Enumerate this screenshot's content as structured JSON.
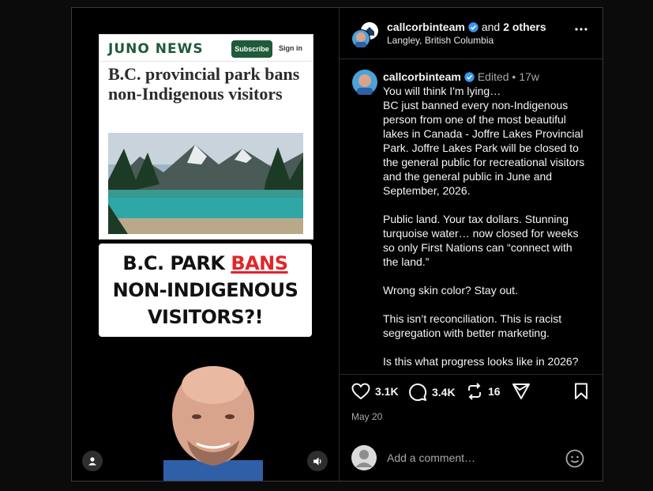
{
  "media": {
    "news_brand": "JUNO NEWS",
    "subscribe_label": "Subscribe",
    "signin_label": "Sign in",
    "headline": "B.C. provincial park bans non-Indigenous visitors",
    "banner_line1_prefix": "B.C. PARK ",
    "banner_line1_highlight": "BANS",
    "banner_line2": "NON-INDIGENOUS",
    "banner_line3": "VISITORS?!"
  },
  "header": {
    "username": "callcorbinteam",
    "and_text": "and",
    "others": "2 others",
    "location": "Langley, British Columbia"
  },
  "caption": {
    "username": "callcorbinteam",
    "edited": "Edited •",
    "time": "17w",
    "text": "You will think I'm lying…\nBC just banned every non-Indigenous person from one of the most beautiful lakes in Canada - Joffre Lakes Provincial Park. Joffre Lakes Park will be closed to the general public for recreational visitors and the general public in June and September, 2026.\n\nPublic land. Your tax dollars. Stunning turquoise water… now closed for weeks so only First Nations can “connect with the land.”\n\nWrong skin color? Stay out.\n\nThis isn’t reconciliation. This is racist segregation with better marketing.\n\nIs this what progress looks like in 2026?"
  },
  "actions": {
    "likes": "3.1K",
    "comments": "3.4K",
    "reposts": "16"
  },
  "date": "May 20",
  "comment": {
    "placeholder": "Add a comment…"
  },
  "colors": {
    "verified": "#3897f0",
    "brand_green": "#1f5a3a",
    "banner_red": "#e0262a"
  }
}
